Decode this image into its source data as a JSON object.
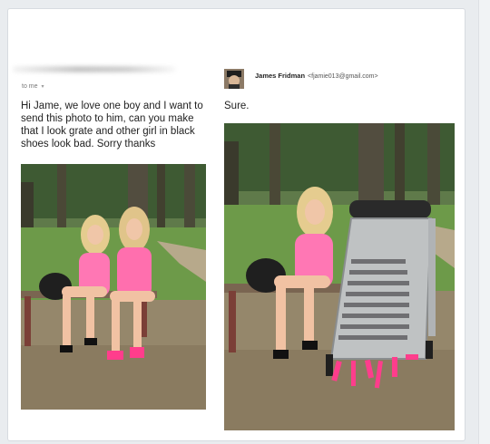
{
  "left_message": {
    "to_label": "to me",
    "to_caret": "▾",
    "body": "Hi Jame, we love one boy and I want to send this photo to him, can you make that I look grate and other girl in black shoes look bad. Sorry thanks"
  },
  "right_message": {
    "sender_name": "James Fridman",
    "sender_email": "<fjamie013@gmail.com>",
    "reply": "Sure."
  },
  "icons": {
    "avatar": "avatar-icon",
    "caret": "chevron-down-icon"
  },
  "colors": {
    "card": "#ffffff",
    "background": "#e9ecef",
    "text": "#222222",
    "dress": "#ff6fae"
  }
}
